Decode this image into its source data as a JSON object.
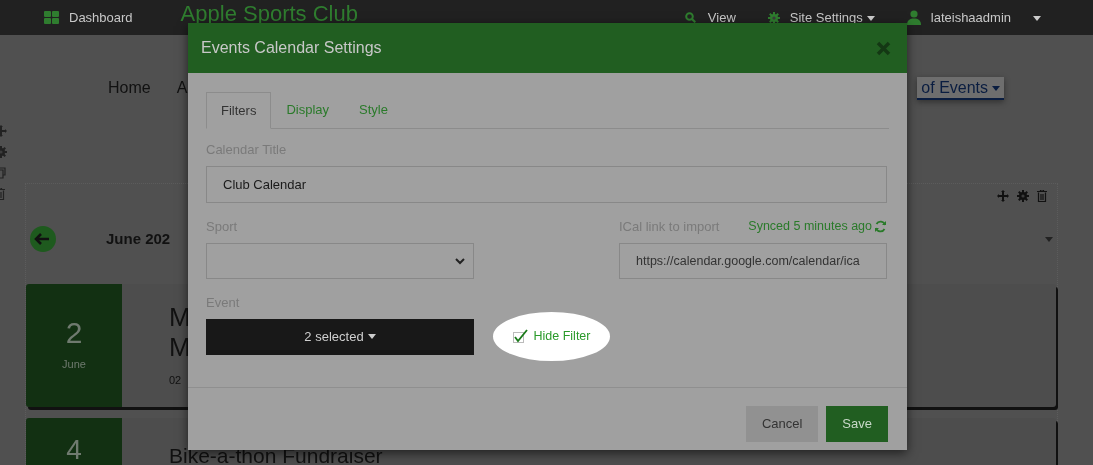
{
  "nav": {
    "dashboard": "Dashboard",
    "site_title": "Apple Sports Club",
    "view": "View",
    "site_settings": "Site Settings",
    "user": "lateishaadmin"
  },
  "page_menu": [
    {
      "label": "Home",
      "selected": false
    },
    {
      "label": "A",
      "selected": false
    },
    {
      "label": "of Events",
      "selected": true
    }
  ],
  "calendar": {
    "month": "June 202",
    "events": [
      {
        "day": "2",
        "month": "June",
        "title_lines": [
          "M",
          "M"
        ],
        "date": "02"
      },
      {
        "day": "4",
        "title_lines": [
          "Bike-a-thon Fundraiser"
        ]
      }
    ]
  },
  "modal": {
    "title": "Events Calendar Settings",
    "tabs": [
      {
        "label": "Filters",
        "selected": true
      },
      {
        "label": "Display",
        "selected": false
      },
      {
        "label": "Style",
        "selected": false
      }
    ],
    "calendar_title": {
      "label": "Calendar Title",
      "value": "Club Calendar"
    },
    "sport": {
      "label": "Sport"
    },
    "ical": {
      "label": "ICal link to import",
      "sync_status": "Synced 5 minutes ago",
      "value": "https://calendar.google.com/calendar/ica"
    },
    "event": {
      "label": "Event",
      "value": "2 selected"
    },
    "hide_filter": {
      "label": "Hide Filter",
      "checked": true
    },
    "buttons": [
      {
        "label": "Cancel",
        "kind": "secondary"
      },
      {
        "label": "Save",
        "kind": "primary"
      }
    ]
  }
}
